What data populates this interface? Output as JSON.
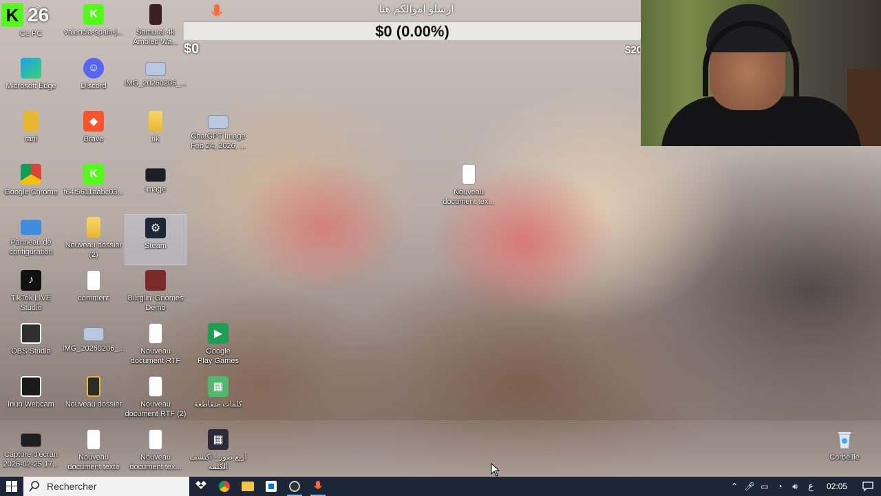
{
  "colors": {
    "taskbar": "#1c2636",
    "kick_green": "#53fc18",
    "progress_bg": "#ebebeb",
    "taskbar_active": "#76b9ed"
  },
  "overlay": {
    "badge_letter": "K",
    "badge_count": "26",
    "donation_title": "ارسلو اموالكم هنا",
    "donation_amount": "$0 (0.00%)",
    "donation_progress_percent": 0,
    "donation_min": "$0",
    "donation_max": "$20"
  },
  "desktop": {
    "icons": [
      {
        "id": "ce-pc",
        "label": "Ce PC",
        "icon": "computer-icon"
      },
      {
        "id": "valencia",
        "label": "valencia-spain-j...",
        "icon": "kick-icon"
      },
      {
        "id": "samurai",
        "label": "Samurai 4k\nAmoled Wa...",
        "icon": "image-file-icon"
      },
      {
        "id": "edge",
        "label": "Microsoft Edge",
        "icon": "edge-icon"
      },
      {
        "id": "discord",
        "label": "Discord",
        "icon": "discord-icon"
      },
      {
        "id": "img1",
        "label": "IMG_20260206_...",
        "icon": "image-file-icon"
      },
      {
        "id": "rani",
        "label": "rani",
        "icon": "user-folder-icon"
      },
      {
        "id": "brave",
        "label": "Brave",
        "icon": "brave-icon"
      },
      {
        "id": "tik",
        "label": "tik",
        "icon": "folder-icon"
      },
      {
        "id": "chatgpt",
        "label": "ChatGPT Image\nFeb 24, 2026, ...",
        "icon": "image-file-icon"
      },
      {
        "id": "chrome",
        "label": "Google Chrome",
        "icon": "chrome-icon"
      },
      {
        "id": "f64",
        "label": "f64f5611aabc03...",
        "icon": "kick-icon"
      },
      {
        "id": "image",
        "label": "image",
        "icon": "screenshot-file-icon"
      },
      {
        "id": "panneau",
        "label": "Panneau de\nconfiguration",
        "icon": "control-panel-icon"
      },
      {
        "id": "nouveau2",
        "label": "Nouveau dossier\n(2)",
        "icon": "folder-icon"
      },
      {
        "id": "steam",
        "label": "Steam",
        "icon": "steam-icon"
      },
      {
        "id": "tiktok",
        "label": "TikTok LIVE\nStudio",
        "icon": "tiktok-icon"
      },
      {
        "id": "comment",
        "label": "comment",
        "icon": "text-document-icon"
      },
      {
        "id": "burglin",
        "label": "Burglin' Gnomes\nDemo",
        "icon": "game-icon"
      },
      {
        "id": "obs",
        "label": "OBS Studio",
        "icon": "obs-icon"
      },
      {
        "id": "img2",
        "label": "IMG_20260206_...",
        "icon": "image-file-icon"
      },
      {
        "id": "rtf1",
        "label": "Nouveau\ndocument RTF",
        "icon": "rtf-document-icon"
      },
      {
        "id": "gplay",
        "label": "Google\nPlay Games",
        "icon": "play-games-icon"
      },
      {
        "id": "iriun",
        "label": "Iriun Webcam",
        "icon": "webcam-icon"
      },
      {
        "id": "nouveau",
        "label": "Nouveau dossier",
        "icon": "folder-icon"
      },
      {
        "id": "rtf2",
        "label": "Nouveau\ndocument RTF (2)",
        "icon": "rtf-document-icon"
      },
      {
        "id": "words",
        "label": "كلمات متقاطعة",
        "icon": "game-icon"
      },
      {
        "id": "capture",
        "label": "Capture d'écran\n2026-02-25 17...",
        "icon": "screenshot-file-icon"
      },
      {
        "id": "txt1",
        "label": "Nouveau\ndocument texte",
        "icon": "text-document-icon"
      },
      {
        "id": "txt2",
        "label": "Nouveau\ndocument tex...",
        "icon": "text-document-icon"
      },
      {
        "id": "pics",
        "label": "أربع صور - اكتشف\nالكلمة",
        "icon": "game-icon"
      },
      {
        "id": "txt3",
        "label": "Nouveau\ndocument tex...",
        "icon": "text-document-icon"
      },
      {
        "id": "bin",
        "label": "Corbeille",
        "icon": "recycle-bin-icon"
      }
    ]
  },
  "taskbar": {
    "search_placeholder": "Rechercher",
    "apps": [
      "tidal-icon",
      "chrome-icon",
      "file-explorer-icon",
      "store-icon",
      "obs-icon",
      "microphone-icon"
    ],
    "language": "ع",
    "time": "02:05"
  }
}
